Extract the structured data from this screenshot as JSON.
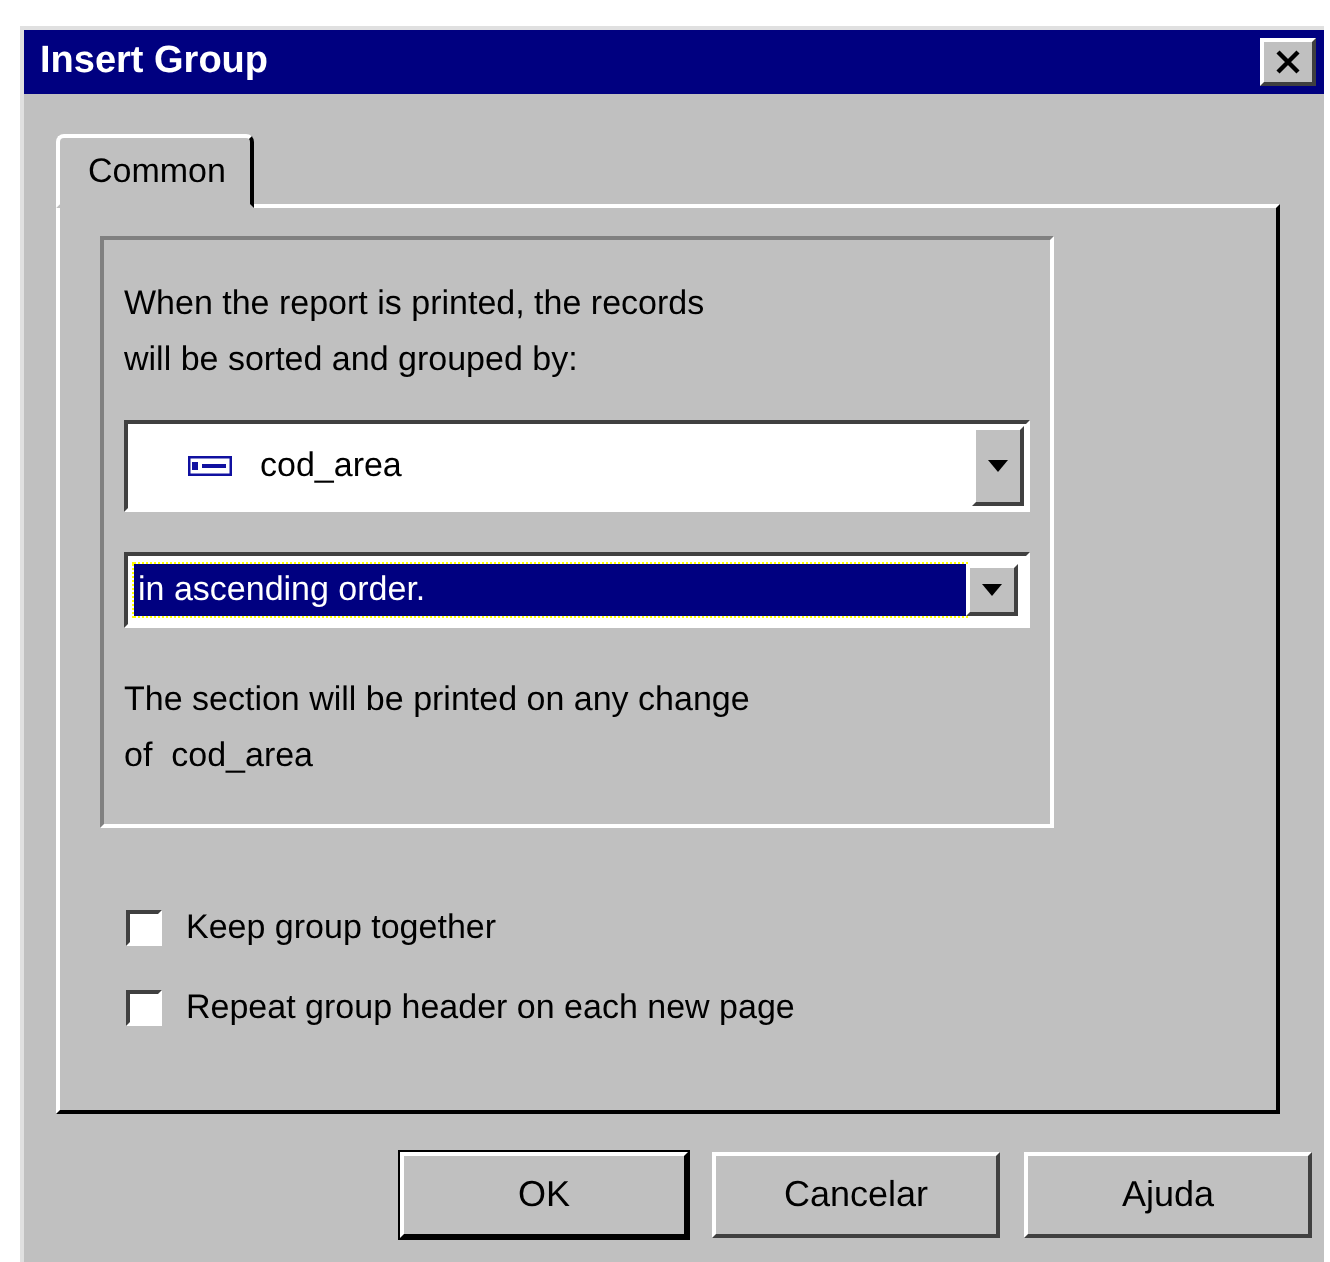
{
  "window": {
    "title": "Insert Group"
  },
  "tabs": [
    {
      "label": "Common",
      "selected": true
    }
  ],
  "group": {
    "intro_lines": [
      "When the report is printed, the records",
      "will be sorted and grouped by:"
    ],
    "field_combo": {
      "value": "cod_area"
    },
    "order_combo": {
      "value": "in ascending order.",
      "focused": true
    },
    "note_lines": [
      "The section will be printed on any change",
      "of  cod_area"
    ]
  },
  "options": [
    {
      "label": "Keep group together",
      "checked": false
    },
    {
      "label": "Repeat group header on each new page",
      "checked": false
    }
  ],
  "buttons": [
    {
      "label": "OK",
      "default": true
    },
    {
      "label": "Cancelar",
      "default": false
    },
    {
      "label": "Ajuda",
      "default": false
    }
  ]
}
